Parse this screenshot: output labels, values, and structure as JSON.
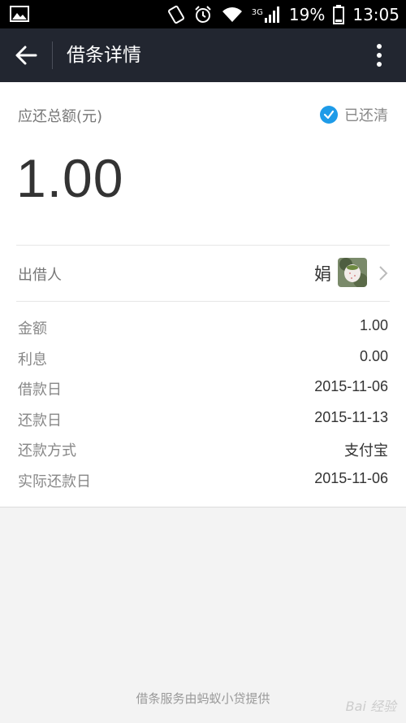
{
  "status_bar": {
    "network": "3G",
    "battery": "19%",
    "time": "13:05"
  },
  "toolbar": {
    "title": "借条详情"
  },
  "summary": {
    "amount_label": "应还总额(元)",
    "status": "已还清",
    "amount": "1.00"
  },
  "lender": {
    "label": "出借人",
    "name": "娟"
  },
  "details": [
    {
      "label": "金额",
      "value": "1.00"
    },
    {
      "label": "利息",
      "value": "0.00"
    },
    {
      "label": "借款日",
      "value": "2015-11-06"
    },
    {
      "label": "还款日",
      "value": "2015-11-13"
    },
    {
      "label": "还款方式",
      "value": "支付宝"
    },
    {
      "label": "实际还款日",
      "value": "2015-11-06"
    }
  ],
  "footer": {
    "text": "借条服务由蚂蚁小贷提供"
  },
  "watermark": "Bai 经验",
  "colors": {
    "toolbar_bg": "#222630",
    "status_check": "#1e9be8",
    "page_bg": "#f3f3f3"
  }
}
